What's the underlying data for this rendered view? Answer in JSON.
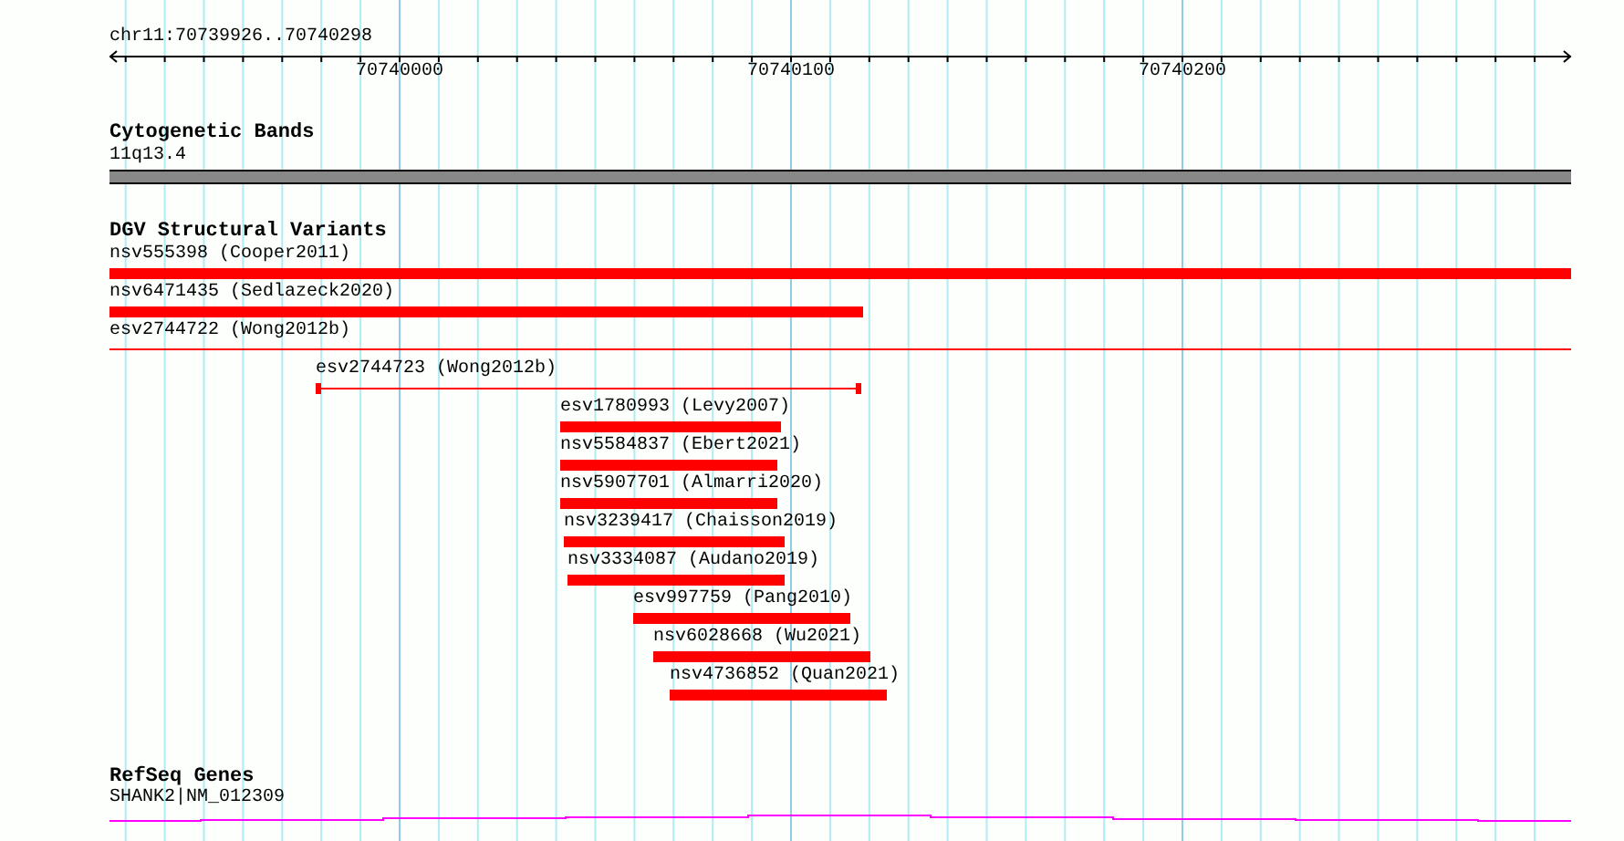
{
  "ruler": {
    "range": "chr11:70739926..70740298",
    "ticks": [
      "70740000",
      "70740100",
      "70740200"
    ]
  },
  "tracks": [
    {
      "title": "Cytogenetic Bands",
      "features": [
        {
          "label": "11q13.4",
          "kind": "band"
        }
      ]
    },
    {
      "title": "DGV Structural Variants",
      "features": [
        {
          "label": "nsv555398 (Cooper2011)",
          "kind": "bar"
        },
        {
          "label": "nsv6471435 (Sedlazeck2020)",
          "kind": "bar"
        },
        {
          "label": "esv2744722 (Wong2012b)",
          "kind": "line"
        },
        {
          "label": "esv2744723 (Wong2012b)",
          "kind": "capped-line"
        },
        {
          "label": "esv1780993 (Levy2007)",
          "kind": "bar"
        },
        {
          "label": "nsv5584837 (Ebert2021)",
          "kind": "bar"
        },
        {
          "label": "nsv5907701 (Almarri2020)",
          "kind": "bar"
        },
        {
          "label": "nsv3239417 (Chaisson2019)",
          "kind": "bar"
        },
        {
          "label": "nsv3334087 (Audano2019)",
          "kind": "bar"
        },
        {
          "label": "esv997759 (Pang2010)",
          "kind": "bar"
        },
        {
          "label": "nsv6028668 (Wu2021)",
          "kind": "bar"
        },
        {
          "label": "nsv4736852 (Quan2021)",
          "kind": "bar"
        }
      ]
    },
    {
      "title": "RefSeq Genes",
      "features": [
        {
          "label": "SHANK2|NM_012309",
          "kind": "gene"
        }
      ]
    }
  ]
}
